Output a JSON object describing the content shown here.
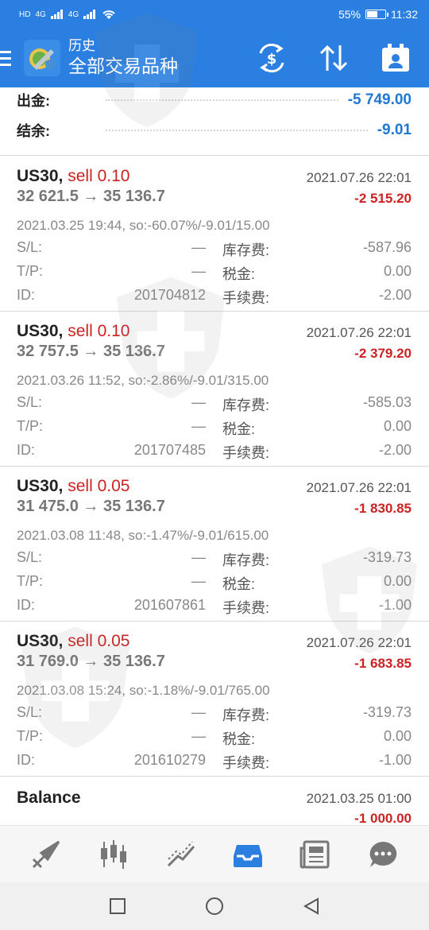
{
  "status_bar": {
    "sim_labels": [
      "HD",
      "4G",
      "4G"
    ],
    "battery_percent": "55%",
    "battery_level": 0.55,
    "time": "11:32"
  },
  "app_bar": {
    "title_top": "历史",
    "title_main": "全部交易品种",
    "icons": [
      "menu-icon",
      "app-logo-icon",
      "currency-exchange-icon",
      "sort-icon",
      "calendar-icon"
    ]
  },
  "summary": {
    "withdrawal_label": "出金:",
    "withdrawal_value": "-5 749.00",
    "balance_label": "结余:",
    "balance_value": "-9.01"
  },
  "deals": [
    {
      "symbol": "US30,",
      "side": "sell 0.10",
      "close_time": "2021.07.26 22:01",
      "prices": "32 621.5 → 35 136.7",
      "profit": "-2 515.20",
      "open_info": "2021.03.25 19:44, so:-60.07%/-9.01/15.00",
      "sl_label": "S/L:",
      "sl_value": "—",
      "swap_label": "库存费:",
      "swap_value": "-587.96",
      "tp_label": "T/P:",
      "tp_value": "—",
      "tax_label": "税金:",
      "tax_value": "0.00",
      "id_label": "ID:",
      "id_value": "201704812",
      "fee_label": "手续费:",
      "fee_value": "-2.00"
    },
    {
      "symbol": "US30,",
      "side": "sell 0.10",
      "close_time": "2021.07.26 22:01",
      "prices": "32 757.5 → 35 136.7",
      "profit": "-2 379.20",
      "open_info": "2021.03.26 11:52, so:-2.86%/-9.01/315.00",
      "sl_label": "S/L:",
      "sl_value": "—",
      "swap_label": "库存费:",
      "swap_value": "-585.03",
      "tp_label": "T/P:",
      "tp_value": "—",
      "tax_label": "税金:",
      "tax_value": "0.00",
      "id_label": "ID:",
      "id_value": "201707485",
      "fee_label": "手续费:",
      "fee_value": "-2.00"
    },
    {
      "symbol": "US30,",
      "side": "sell 0.05",
      "close_time": "2021.07.26 22:01",
      "prices": "31 475.0 → 35 136.7",
      "profit": "-1 830.85",
      "open_info": "2021.03.08 11:48, so:-1.47%/-9.01/615.00",
      "sl_label": "S/L:",
      "sl_value": "—",
      "swap_label": "库存费:",
      "swap_value": "-319.73",
      "tp_label": "T/P:",
      "tp_value": "—",
      "tax_label": "税金:",
      "tax_value": "0.00",
      "id_label": "ID:",
      "id_value": "201607861",
      "fee_label": "手续费:",
      "fee_value": "-1.00"
    },
    {
      "symbol": "US30,",
      "side": "sell 0.05",
      "close_time": "2021.07.26 22:01",
      "prices": "31 769.0 → 35 136.7",
      "profit": "-1 683.85",
      "open_info": "2021.03.08 15:24, so:-1.18%/-9.01/765.00",
      "sl_label": "S/L:",
      "sl_value": "—",
      "swap_label": "库存费:",
      "swap_value": "-319.73",
      "tp_label": "T/P:",
      "tp_value": "—",
      "tax_label": "税金:",
      "tax_value": "0.00",
      "id_label": "ID:",
      "id_value": "201610279",
      "fee_label": "手续费:",
      "fee_value": "-1.00"
    }
  ],
  "balance_entry": {
    "label": "Balance",
    "time": "2021.03.25 01:00",
    "value": "-1 000.00"
  },
  "bottom_nav": [
    "quotes-icon",
    "chart-icon",
    "trade-icon",
    "history-icon",
    "news-icon",
    "chat-icon"
  ],
  "colors": {
    "primary": "#2a7fe0",
    "loss": "#cc2222",
    "positive_blue": "#1e78d4"
  }
}
